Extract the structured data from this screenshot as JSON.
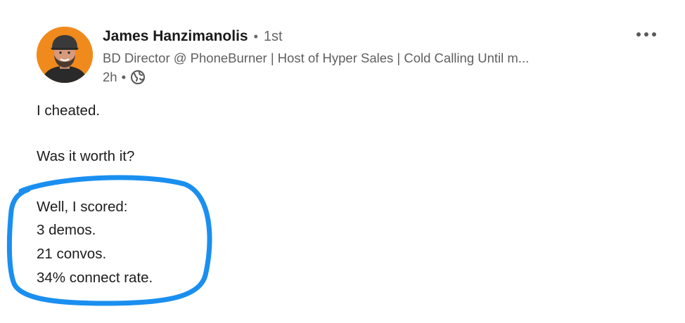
{
  "author": {
    "name": "James Hanzimanolis",
    "separator": "•",
    "degree": "1st",
    "headline": "BD Director @ PhoneBurner | Host of Hyper Sales | Cold Calling Until m...",
    "time": "2h",
    "time_separator": "•",
    "visibility_icon": "globe-icon"
  },
  "post": {
    "lines": [
      "I cheated.",
      "Was it worth it?",
      "Well, I scored:",
      "3 demos.",
      "21 convos.",
      "34% connect rate."
    ]
  },
  "colors": {
    "annotation_circle": "#1a8ff0",
    "avatar_bg": "#f08a1d"
  }
}
